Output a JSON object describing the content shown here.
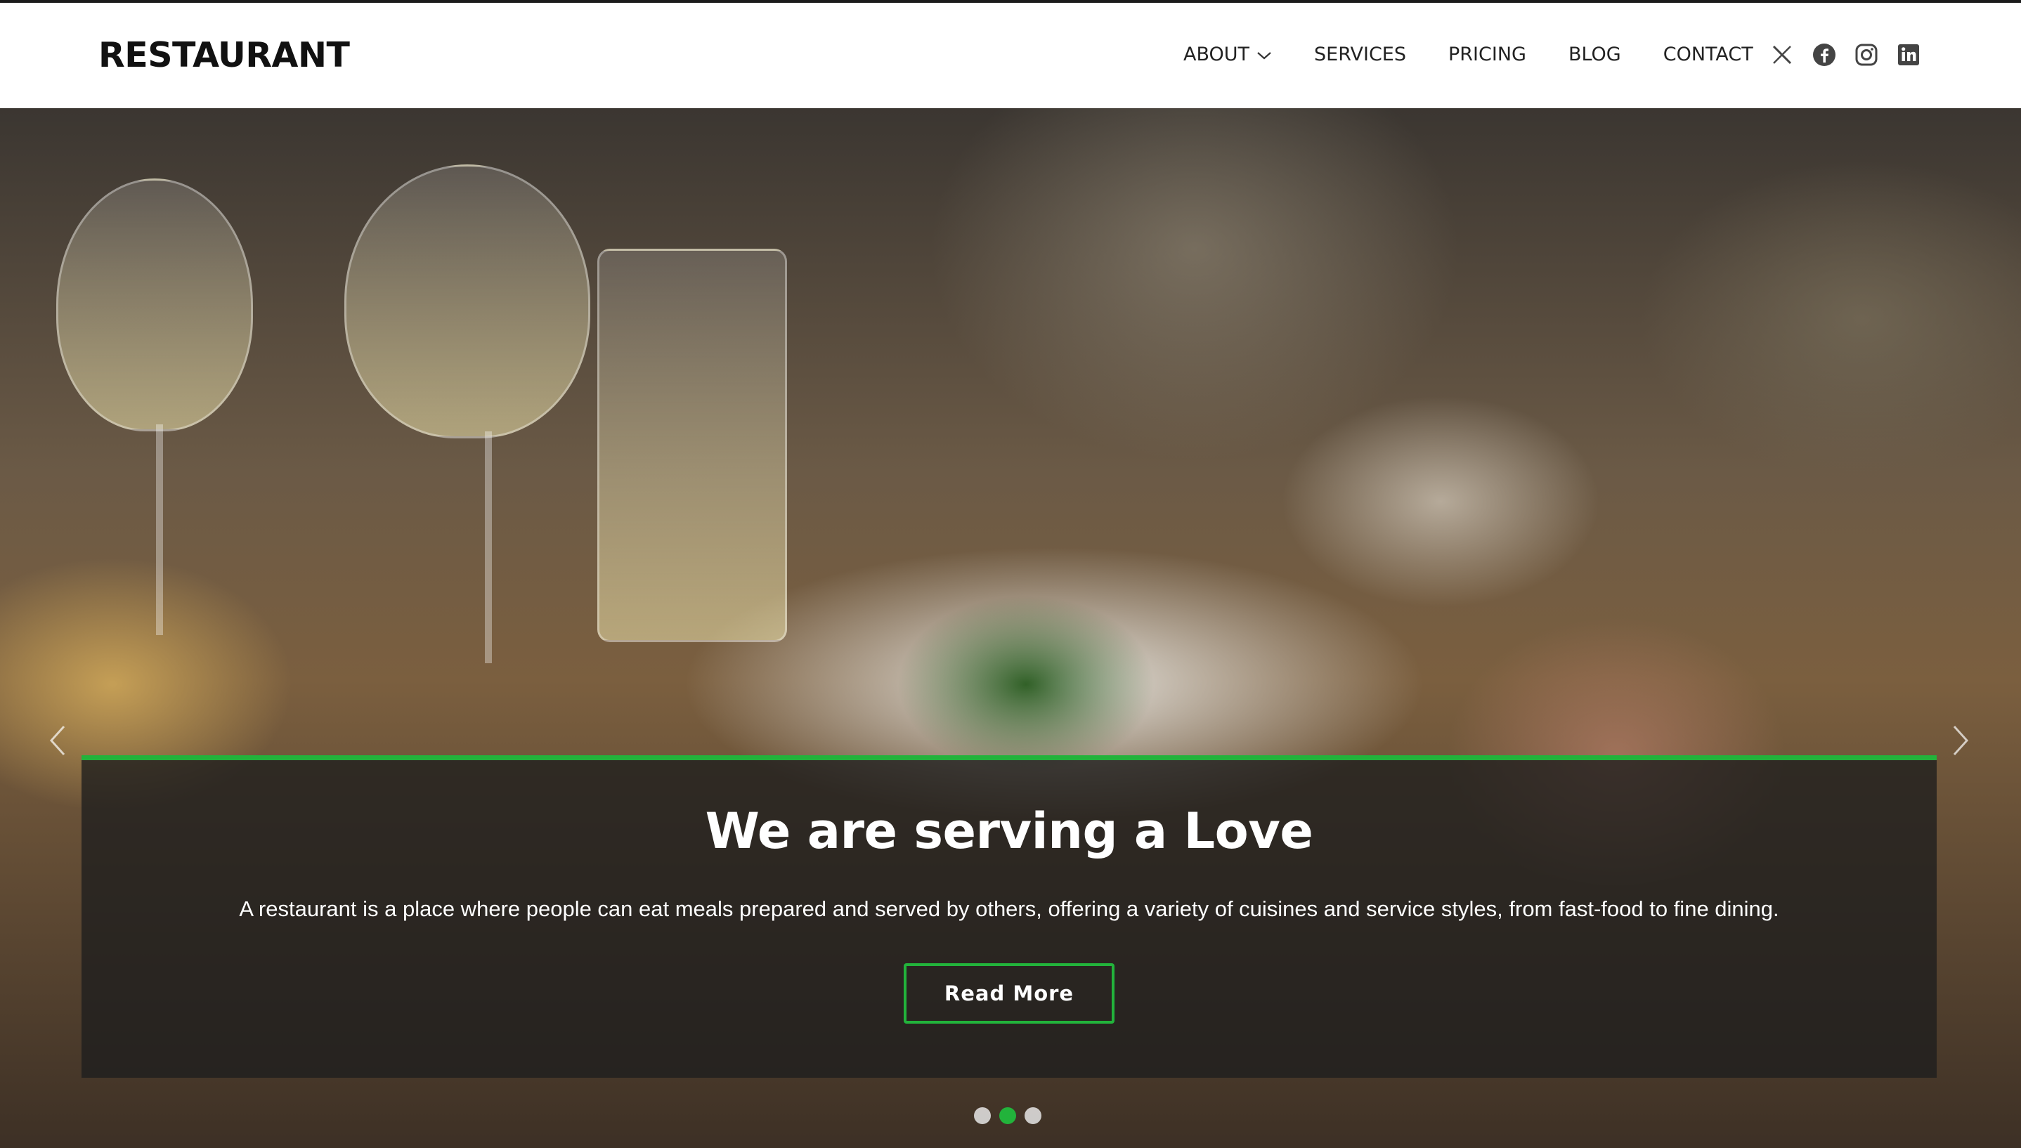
{
  "brand": {
    "name": "RESTAURANT"
  },
  "nav": {
    "items": [
      {
        "label": "ABOUT",
        "has_dropdown": true
      },
      {
        "label": "SERVICES"
      },
      {
        "label": "PRICING"
      },
      {
        "label": "BLOG"
      },
      {
        "label": "CONTACT"
      }
    ],
    "social_icons": [
      "x-icon",
      "facebook-icon",
      "instagram-icon",
      "linkedin-icon"
    ]
  },
  "hero": {
    "title": "We are serving a Love",
    "description": "A restaurant is a place where people can eat meals prepared and served by others, offering a variety of cuisines and service styles, from fast-food to fine dining.",
    "button_label": "Read More",
    "slides_count": 3,
    "active_slide": 2
  },
  "colors": {
    "accent": "#22b33b",
    "caption_bg": "rgba(30,30,30,0.78)",
    "header_bg": "#ffffff",
    "brand_text": "#111111"
  }
}
